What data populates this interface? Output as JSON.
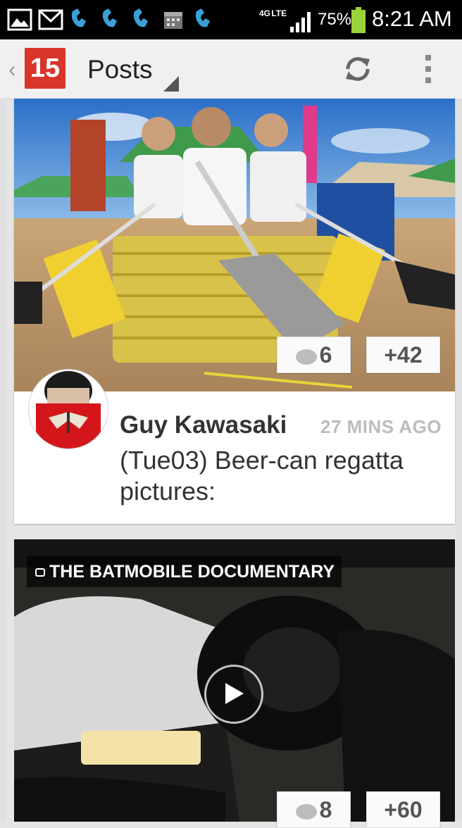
{
  "status_bar": {
    "network": "4G LTE",
    "battery": "75%",
    "time": "8:21 AM",
    "icons": [
      "image-icon",
      "gmail-icon",
      "phone-icon",
      "phone-icon",
      "phone-icon",
      "calendar-icon",
      "phone-icon"
    ]
  },
  "action_bar": {
    "app_badge": "15",
    "title": "Posts",
    "refresh_icon": "refresh-icon",
    "overflow_icon": "overflow-menu-icon"
  },
  "posts": [
    {
      "author": "Guy Kawasaki",
      "time": "27 MINS AGO",
      "text": "(Tue03) Beer-can regatta pictures:",
      "comments": "6",
      "plus": "+42",
      "image_desc": "photo"
    },
    {
      "video_title": "THE BATMOBILE DOCUMENTARY",
      "comments": "8",
      "plus": "+60"
    }
  ],
  "colors": {
    "badge": "#d9352b",
    "background": "#e5e5e5",
    "time_text": "#bcbcbc"
  }
}
